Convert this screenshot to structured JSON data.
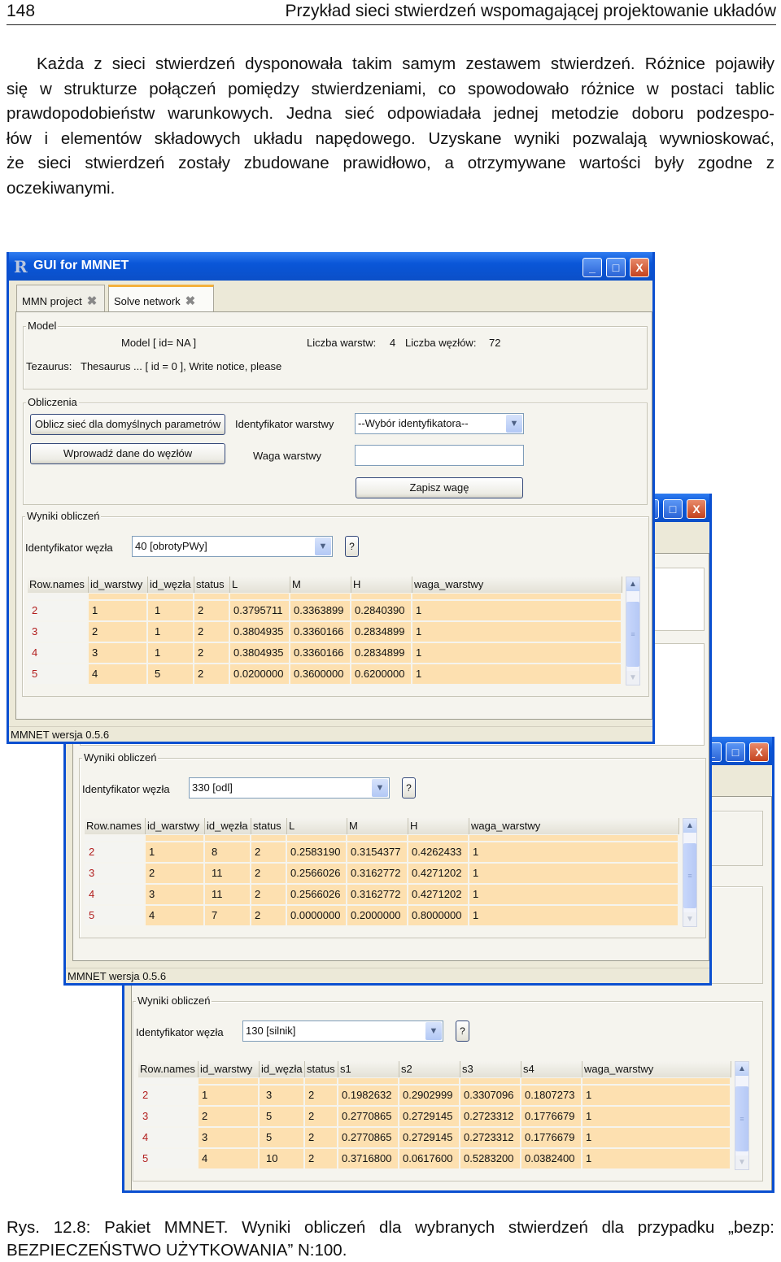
{
  "page": {
    "number": "148",
    "running_title": "Przykład sieci stwierdzeń wspomagającej projektowanie układów",
    "paragraph_lines": [
      "Każda z sieci stwierdzeń dysponowała takim samym zestawem stwierdzeń. Różnice pojawiły",
      "się w strukturze połączeń pomiędzy stwierdzeniami, co spowodowało różnice w postaci tablic",
      "prawdopodobieństw warunkowych. Jedna sieć odpowiadała jednej metodzie doboru podzespo-",
      "łów i elementów składowych układu napędowego. Uzyskane wyniki pozwalają wywnioskować,",
      "że sieci stwierdzeń zostały zbudowane prawidłowo, a otrzymywane wartości były zgodne z",
      "oczekiwanymi."
    ],
    "caption_lines": [
      "Rys. 12.8: Pakiet MMNET. Wyniki obliczeń dla wybranych stwierdzeń dla przypadku „bezp:",
      "BEZPIECZEŃSTWO UŻYTKOWANIA” N:100."
    ]
  },
  "windows": [
    {
      "title": "GUI for MMNET",
      "app_icon": "R-logo-icon",
      "controls": {
        "minimize": "_",
        "maximize": "□",
        "close": "X"
      },
      "tabs": [
        {
          "label": "MMN project",
          "active": false
        },
        {
          "label": "Solve network",
          "active": true
        }
      ],
      "model": {
        "legend": "Model",
        "model_text": "Model [ id= NA ]",
        "layers_label": "Liczba warstw:",
        "layers_value": "4",
        "nodes_label": "Liczba węzłów:",
        "nodes_value": "72",
        "thesaurus_label": "Tezaurus:",
        "thesaurus_value": "Thesaurus ... [ id = 0 ], Write notice, please"
      },
      "obliczenia": {
        "legend": "Obliczenia",
        "compute_button": "Oblicz sieć dla domyślnych parametrów",
        "enter_data_button": "Wprowadź dane do węzłów",
        "layer_id_label": "Identyfikator warstwy",
        "layer_id_value": "--Wybór identyfikatora--",
        "weight_label": "Waga warstwy",
        "weight_value": "",
        "save_button": "Zapisz wagę"
      },
      "results": {
        "legend": "Wyniki obliczeń",
        "node_label": "Identyfikator węzła",
        "node_value": "40 [obrotyPWy]",
        "help": "?",
        "columns": [
          "Row.names",
          "id_warstwy",
          "id_węzła",
          "status",
          "L",
          "M",
          "H",
          "waga_warstwy"
        ],
        "rows": [
          [
            "2",
            "1",
            "1",
            "2",
            "0.3795711",
            "0.3363899",
            "0.2840390",
            "1"
          ],
          [
            "3",
            "2",
            "1",
            "2",
            "0.3804935",
            "0.3360166",
            "0.2834899",
            "1"
          ],
          [
            "4",
            "3",
            "1",
            "2",
            "0.3804935",
            "0.3360166",
            "0.2834899",
            "1"
          ],
          [
            "5",
            "4",
            "5",
            "2",
            "0.0200000",
            "0.3600000",
            "0.6200000",
            "1"
          ]
        ]
      },
      "status": "MMNET wersja 0.5.6"
    },
    {
      "controls": {
        "minimize": "_",
        "maximize": "□",
        "close": "X"
      },
      "results": {
        "legend": "Wyniki obliczeń",
        "node_label": "Identyfikator węzła",
        "node_value": "330 [odl]",
        "help": "?",
        "columns": [
          "Row.names",
          "id_warstwy",
          "id_węzła",
          "status",
          "L",
          "M",
          "H",
          "waga_warstwy"
        ],
        "rows": [
          [
            "2",
            "1",
            "8",
            "2",
            "0.2583190",
            "0.3154377",
            "0.4262433",
            "1"
          ],
          [
            "3",
            "2",
            "11",
            "2",
            "0.2566026",
            "0.3162772",
            "0.4271202",
            "1"
          ],
          [
            "4",
            "3",
            "11",
            "2",
            "0.2566026",
            "0.3162772",
            "0.4271202",
            "1"
          ],
          [
            "5",
            "4",
            "7",
            "2",
            "0.0000000",
            "0.2000000",
            "0.8000000",
            "1"
          ]
        ]
      },
      "status": "MMNET wersja 0.5.6"
    },
    {
      "controls": {
        "minimize": "_",
        "maximize": "□",
        "close": "X"
      },
      "results": {
        "legend": "Wyniki obliczeń",
        "node_label": "Identyfikator węzła",
        "node_value": "130 [silnik]",
        "help": "?",
        "columns": [
          "Row.names",
          "id_warstwy",
          "id_węzła",
          "status",
          "s1",
          "s2",
          "s3",
          "s4",
          "waga_warstwy"
        ],
        "rows": [
          [
            "2",
            "1",
            "3",
            "2",
            "0.1982632",
            "0.2902999",
            "0.3307096",
            "0.1807273",
            "1"
          ],
          [
            "3",
            "2",
            "5",
            "2",
            "0.2770865",
            "0.2729145",
            "0.2723312",
            "0.1776679",
            "1"
          ],
          [
            "4",
            "3",
            "5",
            "2",
            "0.2770865",
            "0.2729145",
            "0.2723312",
            "0.1776679",
            "1"
          ],
          [
            "5",
            "4",
            "10",
            "2",
            "0.3716800",
            "0.0617600",
            "0.5283200",
            "0.0382400",
            "1"
          ]
        ]
      }
    }
  ]
}
